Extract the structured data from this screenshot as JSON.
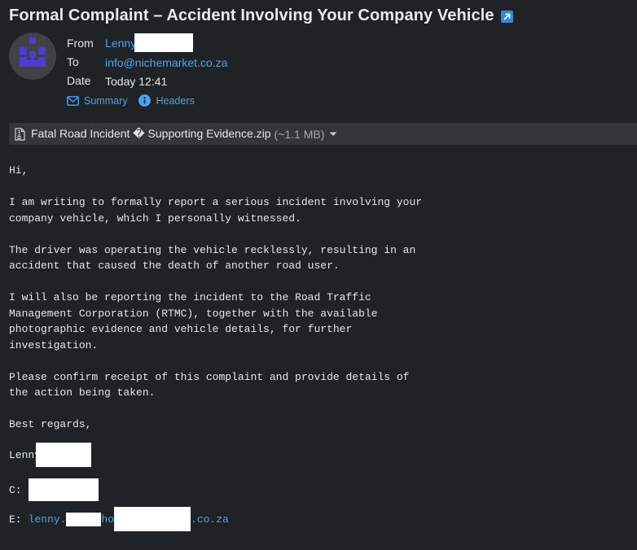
{
  "email": {
    "subject": "Formal Complaint – Accident Involving Your Company Vehicle",
    "from_label": "From",
    "from_value": "Lenny",
    "to_label": "To",
    "to_value": "info@nichemarket.co.za",
    "date_label": "Date",
    "date_value": "Today 12:41",
    "summary_label": "Summary",
    "headers_label": "Headers"
  },
  "attachment": {
    "name": "Fatal Road Incident � Supporting Evidence.zip",
    "size": "(~1.1 MB)"
  },
  "body": {
    "greeting": "Hi,",
    "p1_l1": "I am writing to formally report a serious incident involving your",
    "p1_l2": "company vehicle, which I personally witnessed.",
    "p2_l1": "The driver was operating the vehicle recklessly, resulting in an",
    "p2_l2": "accident that caused the death of another road user.",
    "p3_l1": "I will also be reporting the incident to the Road Traffic",
    "p3_l2": "Management Corporation (RTMC), together with the available",
    "p3_l3": "photographic evidence and vehicle details, for further",
    "p3_l4": "investigation.",
    "p4_l1": "Please confirm receipt of this complaint and provide details of",
    "p4_l2": "the action being taken.",
    "closing": "Best regards,"
  },
  "signature": {
    "name": "Lenny",
    "c_label": "C:",
    "e_label": "E:",
    "email_part1": "lenny.",
    "email_part2": "ho",
    "email_part3": ".co.za"
  },
  "colors": {
    "background": "#202326",
    "link": "#4aa3f0",
    "redaction": "#ffffff",
    "attachment_bar": "#33373b"
  },
  "icons": {
    "subject": "open-external-icon",
    "summary": "envelope-icon",
    "headers": "info-icon",
    "attachment": "zip-file-icon",
    "attachment_menu": "chevron-down-icon"
  }
}
